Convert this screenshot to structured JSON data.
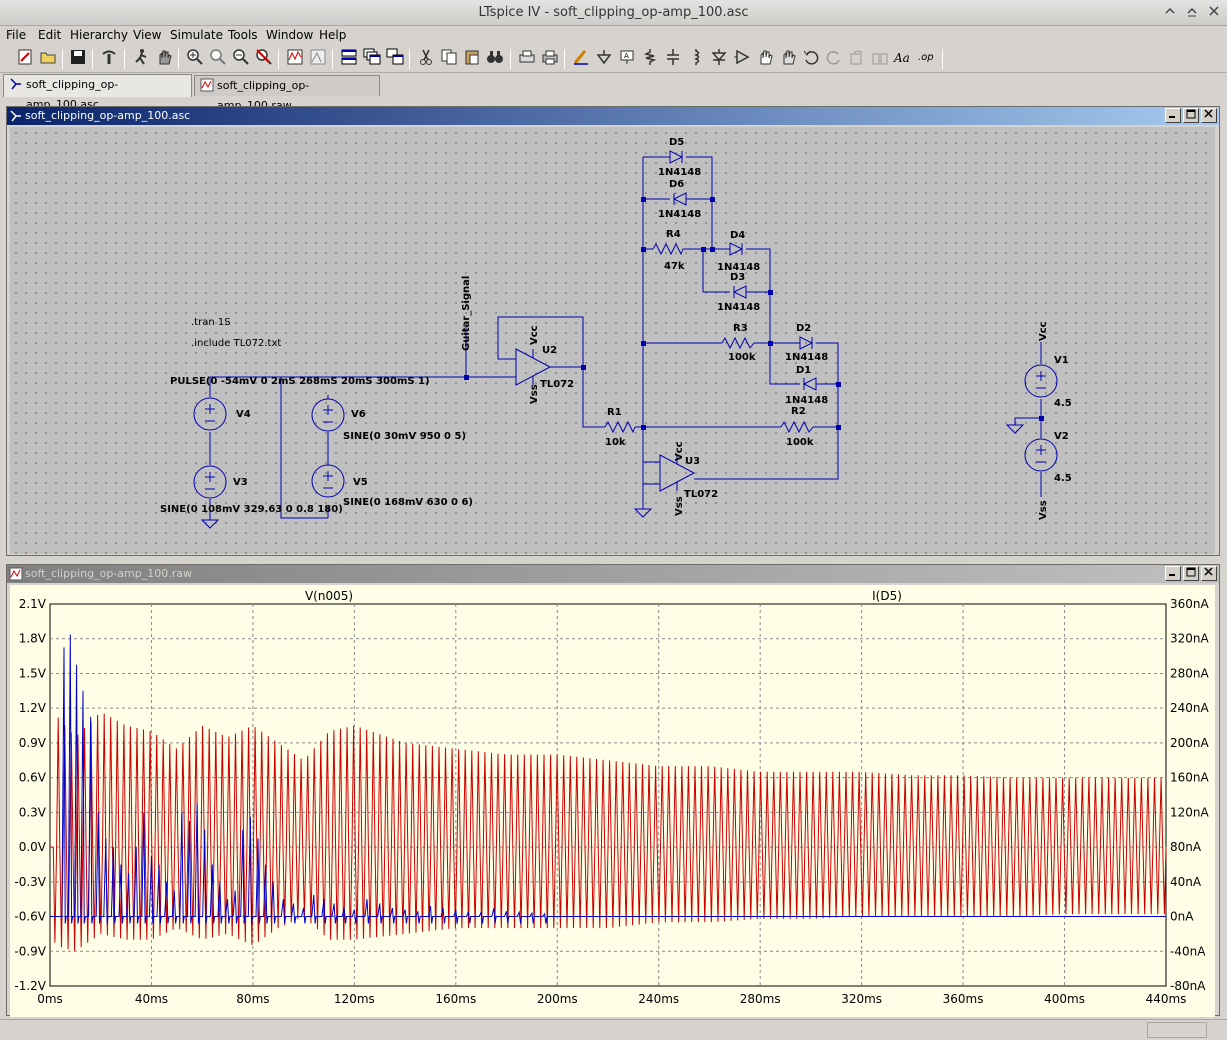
{
  "window": {
    "title": "LTspice IV - soft_clipping_op-amp_100.asc",
    "minimize_glyph": "⌃",
    "restore_glyph": "⌃",
    "close_glyph": "✕"
  },
  "menu": {
    "items": [
      "File",
      "Edit",
      "Hierarchy",
      "View",
      "Simulate",
      "Tools",
      "Window",
      "Help"
    ]
  },
  "toolbar": {
    "icons": [
      "new-schematic-icon",
      "open-icon",
      "save-icon",
      "control-panel-icon",
      "run-icon",
      "halt-icon",
      "zoom-in-icon",
      "zoom-pan-icon",
      "zoom-out-icon",
      "zoom-cancel-icon",
      "autorange-icon",
      "view-fft-icon",
      "tile-horizontal-icon",
      "cascade-icon",
      "tile-vertical-icon",
      "cut-icon",
      "copy-icon",
      "paste-icon",
      "find-icon",
      "print-setup-icon",
      "print-icon",
      "draw-wire-icon",
      "ground-icon",
      "label-net-icon",
      "resistor-icon",
      "capacitor-icon",
      "inductor-icon",
      "diode-icon",
      "component-icon",
      "move-icon",
      "drag-icon",
      "undo-icon",
      "redo-icon",
      "rotate-icon",
      "mirror-icon",
      "text-icon",
      "spice-directive-icon"
    ]
  },
  "tabs": [
    {
      "label": "soft_clipping_op-amp_100.asc",
      "icon": "schematic-icon",
      "active": true
    },
    {
      "label": "soft_clipping_op-amp_100.raw",
      "icon": "waveform-icon",
      "active": false
    }
  ],
  "schematic_window": {
    "title": "soft_clipping_op-amp_100.asc",
    "directives": [
      ".tran 1S",
      ".include TL072.txt"
    ],
    "components": {
      "V4": {
        "name": "V4",
        "value": "PULSE(0 -54mV 0 2mS 268mS 20mS 300mS 1)"
      },
      "V3": {
        "name": "V3",
        "value": "SINE(0 108mV 329.63 0 0.8 180)"
      },
      "V6": {
        "name": "V6",
        "value": "SINE(0 30mV 950 0 5)"
      },
      "V5": {
        "name": "V5",
        "value": "SINE(0 168mV 630 0 6)"
      },
      "U2": {
        "name": "U2",
        "value": "TL072"
      },
      "U3": {
        "name": "U3",
        "value": "TL072"
      },
      "R1": {
        "name": "R1",
        "value": "10k"
      },
      "R2": {
        "name": "R2",
        "value": "100k"
      },
      "R3": {
        "name": "R3",
        "value": "100k"
      },
      "R4": {
        "name": "R4",
        "value": "47k"
      },
      "D1": {
        "name": "D1",
        "value": "1N4148"
      },
      "D2": {
        "name": "D2",
        "value": "1N4148"
      },
      "D3": {
        "name": "D3",
        "value": "1N4148"
      },
      "D4": {
        "name": "D4",
        "value": "1N4148"
      },
      "D5": {
        "name": "D5",
        "value": "1N4148"
      },
      "D6": {
        "name": "D6",
        "value": "1N4148"
      },
      "V1": {
        "name": "V1",
        "value": "4.5"
      },
      "V2": {
        "name": "V2",
        "value": "4.5"
      }
    },
    "net_labels": {
      "guitar": "Guitar_Signal",
      "vcc": "Vcc",
      "vss": "Vss"
    }
  },
  "waveform_window": {
    "title": "soft_clipping_op-amp_100.raw"
  },
  "chart_data": {
    "type": "line",
    "x_unit": "ms",
    "xlim": [
      0,
      440
    ],
    "x_ticks": [
      "0ms",
      "40ms",
      "80ms",
      "120ms",
      "160ms",
      "200ms",
      "240ms",
      "280ms",
      "320ms",
      "360ms",
      "400ms",
      "440ms"
    ],
    "y_left_ticks": [
      "2.1V",
      "1.8V",
      "1.5V",
      "1.2V",
      "0.9V",
      "0.6V",
      "0.3V",
      "0.0V",
      "-0.3V",
      "-0.6V",
      "-0.9V",
      "-1.2V"
    ],
    "y_right_ticks": [
      "360nA",
      "320nA",
      "280nA",
      "240nA",
      "200nA",
      "160nA",
      "120nA",
      "80nA",
      "40nA",
      "0nA",
      "-40nA",
      "-80nA"
    ],
    "ylim_left": [
      -1.2,
      2.1
    ],
    "ylim_right": [
      -80,
      360
    ],
    "grid": true,
    "series": [
      {
        "name": "V(n005)",
        "unit": "V",
        "axis": "left",
        "color": "#cc0000",
        "oscillation_cycles_shown": 170,
        "envelope_x": [
          0,
          2,
          10,
          20,
          30,
          40,
          50,
          60,
          70,
          80,
          90,
          100,
          110,
          120,
          140,
          160,
          180,
          200,
          220,
          240,
          260,
          280,
          300,
          320,
          340,
          360,
          380,
          400,
          420,
          440
        ],
        "envelope_max": [
          0.0,
          1.15,
          0.95,
          1.17,
          1.05,
          1.0,
          0.85,
          1.05,
          0.95,
          1.05,
          0.9,
          0.75,
          1.0,
          1.05,
          0.9,
          0.85,
          0.8,
          0.8,
          0.75,
          0.7,
          0.7,
          0.65,
          0.65,
          0.65,
          0.62,
          0.62,
          0.6,
          0.6,
          0.6,
          0.6
        ],
        "envelope_min": [
          0.0,
          -0.85,
          -0.9,
          -0.75,
          -0.8,
          -0.8,
          -0.7,
          -0.8,
          -0.75,
          -0.85,
          -0.7,
          -0.6,
          -0.8,
          -0.8,
          -0.75,
          -0.7,
          -0.7,
          -0.7,
          -0.7,
          -0.65,
          -0.65,
          -0.62,
          -0.62,
          -0.6,
          -0.6,
          -0.6,
          -0.6,
          -0.58,
          -0.58,
          -0.58
        ]
      },
      {
        "name": "I(D5)",
        "unit": "nA",
        "axis": "right",
        "color": "#0000cc",
        "baseline": 0,
        "peak_times": [
          5.5,
          8,
          10.5,
          13,
          16,
          19,
          22,
          25,
          28,
          31,
          34,
          37,
          40,
          43,
          46,
          49,
          52,
          55,
          58,
          61,
          64,
          67,
          70,
          73,
          76,
          79,
          82,
          85,
          88,
          92,
          96,
          100,
          104,
          108,
          112,
          116,
          120,
          125,
          130,
          135,
          140,
          145,
          150,
          155,
          160,
          165,
          170,
          175,
          180,
          185,
          190,
          195
        ],
        "peak_values": [
          310,
          325,
          290,
          260,
          230,
          120,
          90,
          80,
          60,
          50,
          80,
          120,
          70,
          60,
          40,
          30,
          120,
          110,
          130,
          100,
          60,
          40,
          20,
          30,
          100,
          115,
          90,
          60,
          40,
          20,
          15,
          10,
          25,
          20,
          15,
          10,
          8,
          20,
          15,
          10,
          8,
          6,
          12,
          10,
          8,
          6,
          5,
          10,
          6,
          5,
          4,
          3
        ],
        "negative_spike_nA": -8
      }
    ]
  },
  "statusbar": {
    "text": ""
  }
}
